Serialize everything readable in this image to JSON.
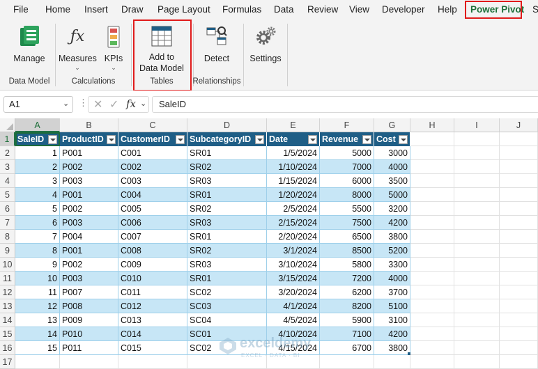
{
  "menu": [
    "File",
    "Home",
    "Insert",
    "Draw",
    "Page Layout",
    "Formulas",
    "Data",
    "Review",
    "View",
    "Developer",
    "Help",
    "Power Pivot",
    "S"
  ],
  "ribbon": {
    "manage": "Manage",
    "measures": "Measures",
    "kpis": "KPIs",
    "add_line1": "Add to",
    "add_line2": "Data Model",
    "detect": "Detect",
    "settings": "Settings",
    "groups": {
      "data_model": "Data Model",
      "calculations": "Calculations",
      "tables": "Tables",
      "relationships": "Relationships"
    }
  },
  "formula_bar": {
    "name_box": "A1",
    "fx": "fx",
    "content": "SaleID"
  },
  "columns": [
    "A",
    "B",
    "C",
    "D",
    "E",
    "F",
    "G",
    "H",
    "I",
    "J"
  ],
  "rows": [
    "1",
    "2",
    "3",
    "4",
    "5",
    "6",
    "7",
    "8",
    "9",
    "10",
    "11",
    "12",
    "13",
    "14",
    "15",
    "16",
    "17"
  ],
  "table": {
    "headers": [
      "SaleID",
      "ProductID",
      "CustomerID",
      "SubcategoryID",
      "Date",
      "Revenue",
      "Cost"
    ],
    "rows": [
      [
        "1",
        "P001",
        "C001",
        "SR01",
        "1/5/2024",
        "5000",
        "3000"
      ],
      [
        "2",
        "P002",
        "C002",
        "SR02",
        "1/10/2024",
        "7000",
        "4000"
      ],
      [
        "3",
        "P003",
        "C003",
        "SR03",
        "1/15/2024",
        "6000",
        "3500"
      ],
      [
        "4",
        "P001",
        "C004",
        "SR01",
        "1/20/2024",
        "8000",
        "5000"
      ],
      [
        "5",
        "P002",
        "C005",
        "SR02",
        "2/5/2024",
        "5500",
        "3200"
      ],
      [
        "6",
        "P003",
        "C006",
        "SR03",
        "2/15/2024",
        "7500",
        "4200"
      ],
      [
        "7",
        "P004",
        "C007",
        "SR01",
        "2/20/2024",
        "6500",
        "3800"
      ],
      [
        "8",
        "P001",
        "C008",
        "SR02",
        "3/1/2024",
        "8500",
        "5200"
      ],
      [
        "9",
        "P002",
        "C009",
        "SR03",
        "3/10/2024",
        "5800",
        "3300"
      ],
      [
        "10",
        "P003",
        "C010",
        "SR01",
        "3/15/2024",
        "7200",
        "4000"
      ],
      [
        "11",
        "P007",
        "C011",
        "SC02",
        "3/20/2024",
        "6200",
        "3700"
      ],
      [
        "12",
        "P008",
        "C012",
        "SC03",
        "4/1/2024",
        "8200",
        "5100"
      ],
      [
        "13",
        "P009",
        "C013",
        "SC04",
        "4/5/2024",
        "5900",
        "3100"
      ],
      [
        "14",
        "P010",
        "C014",
        "SC01",
        "4/10/2024",
        "7100",
        "4200"
      ],
      [
        "15",
        "P011",
        "C015",
        "SC02",
        "4/15/2024",
        "6700",
        "3800"
      ]
    ]
  },
  "watermark": {
    "brand": "exceldemy",
    "tagline": "EXCEL · DATA · BI"
  },
  "colors": {
    "table_header": "#1f5e86",
    "band": "#c7e6f6",
    "highlight": "#e01b1b",
    "excel_green": "#217346"
  }
}
